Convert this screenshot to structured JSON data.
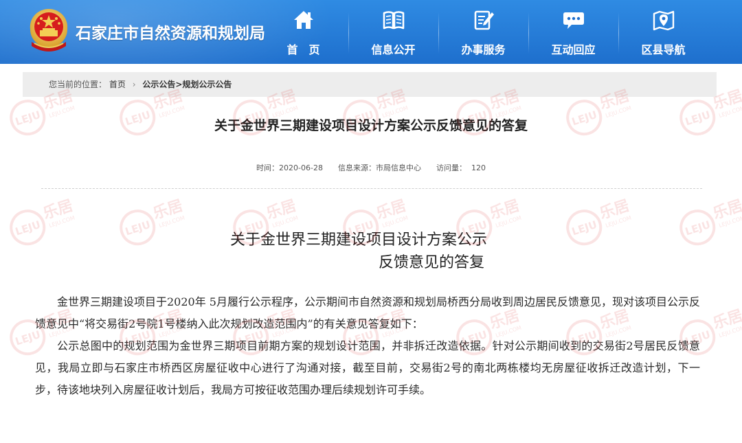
{
  "header": {
    "site_name": "石家庄市自然资源和规划局",
    "nav": [
      {
        "label": "首　页",
        "icon": "home-icon"
      },
      {
        "label": "信息公开",
        "icon": "book-icon"
      },
      {
        "label": "办事服务",
        "icon": "edit-document-icon"
      },
      {
        "label": "互动回应",
        "icon": "chat-bubble-icon"
      },
      {
        "label": "区县导航",
        "icon": "map-pin-icon"
      }
    ]
  },
  "breadcrumb": {
    "prefix": "您当前的位置：",
    "home": "首页",
    "sep": "›",
    "current": "公示公告>规划公示公告"
  },
  "article": {
    "title": "关于金世界三期建设项目设计方案公示反馈意见的答复",
    "date_label": "时间：2020-06-28",
    "source_label": "信息来源：市局信息中心",
    "views_label": "访问量：",
    "views": "120",
    "body_title_line1": "关于金世界三期建设项目设计方案公示",
    "body_title_line2": "反馈意见的答复",
    "paragraphs": [
      "金世界三期建设项目于2020年 5月履行公示程序，公示期间市自然资源和规划局桥西分局收到周边居民反馈意见，现对该项目公示反馈意见中“将交易街2号院1号楼纳入此次规划改造范围内”的有关意见答复如下：",
      "公示总图中的规划范围为金世界三期项目前期方案的规划设计范围，并非拆迁改造依据。针对公示期间收到的交易街2号居民反馈意见，我局立即与石家庄市桥西区房屋征收中心进行了沟通对接，截至目前，交易街2号的南北两栋楼均无房屋征收拆迁改造计划，下一步，待该地块列入房屋征收计划后，我局方可按征收范围办理后续规划许可手续。"
    ]
  },
  "watermark": {
    "brand": "乐居",
    "sub": "LEJU.COM",
    "logo_text": "LEJU",
    "color": "#e03030"
  },
  "colors": {
    "header_blue": "#1e6fcd",
    "breadcrumb_bg": "#ededed"
  }
}
